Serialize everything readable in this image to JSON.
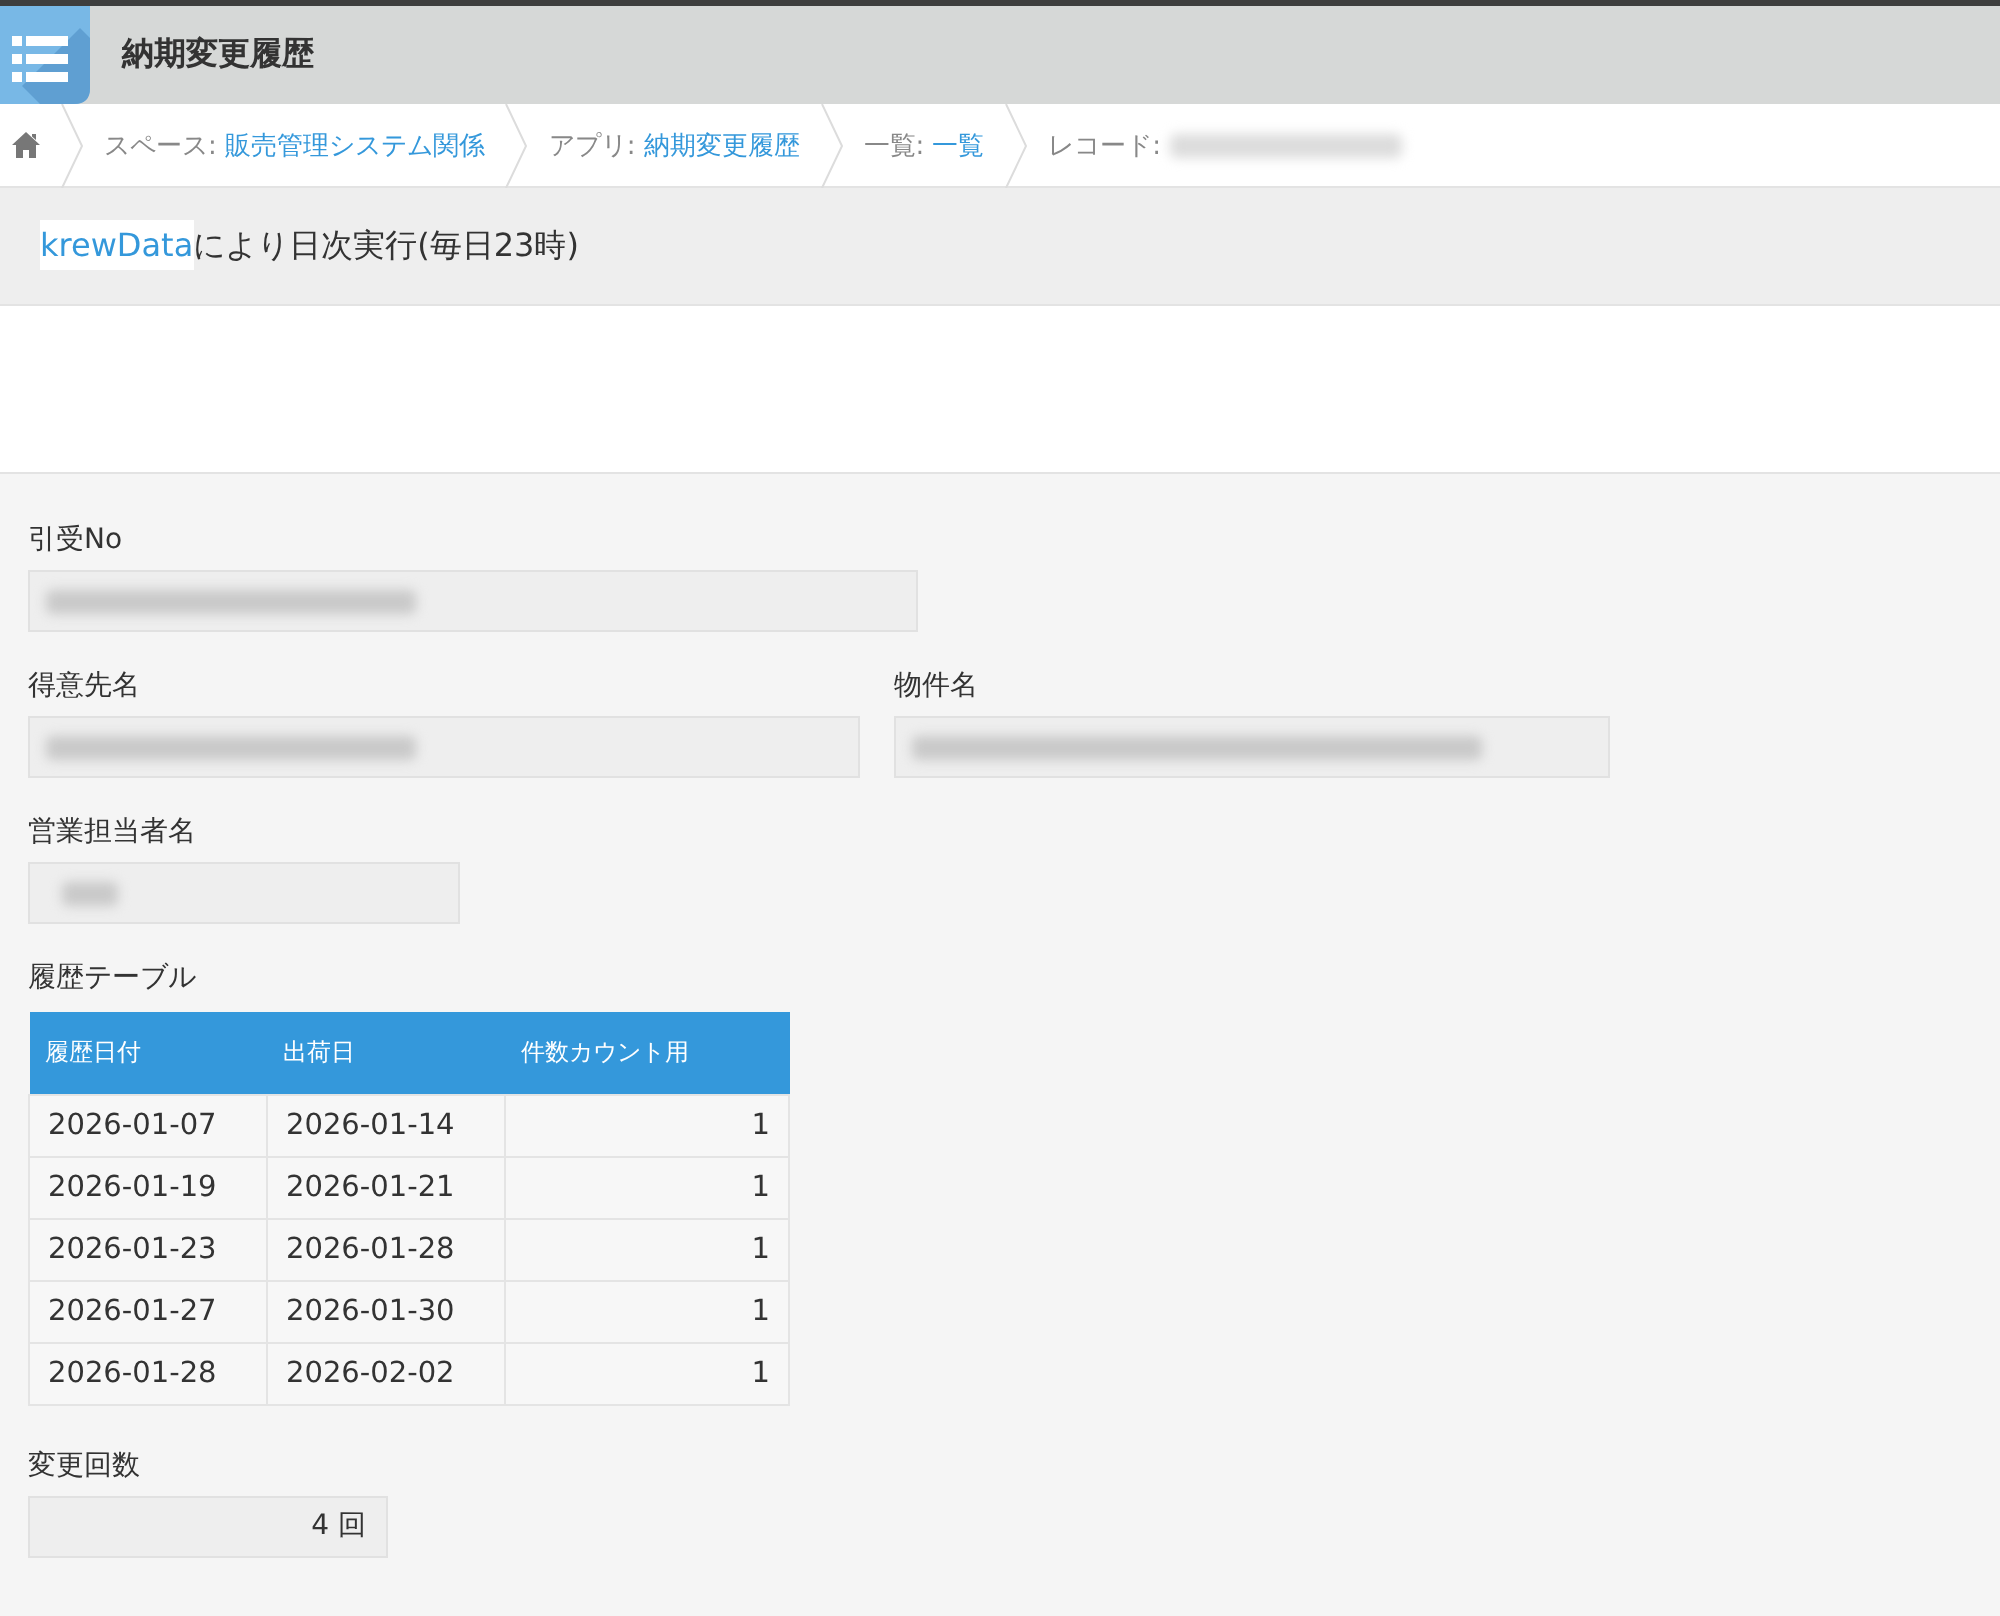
{
  "header": {
    "title": "納期変更履歴"
  },
  "breadcrumb": [
    {
      "label": "スペース:",
      "link": "販売管理システム関係",
      "redacted": false
    },
    {
      "label": "アプリ:",
      "link": "納期変更履歴",
      "redacted": false
    },
    {
      "label": "一覧:",
      "link": "一覧",
      "redacted": false
    },
    {
      "label": "レコード:",
      "redacted": true
    }
  ],
  "notice": {
    "link": "krewData",
    "text": "により日次実行(毎日23時)"
  },
  "form": [
    {
      "kind": "fields",
      "fields": [
        {
          "label": "引受No",
          "kind": "text",
          "redacted": true
        }
      ]
    },
    {
      "kind": "fields",
      "fields": [
        {
          "label": "得意先名",
          "kind": "text",
          "redacted": true
        },
        {
          "label": "物件名",
          "kind": "text",
          "redacted": true
        }
      ]
    },
    {
      "kind": "fields",
      "fields": [
        {
          "label": "営業担当者名",
          "kind": "text",
          "redacted": true
        }
      ]
    },
    {
      "kind": "table",
      "label": "履歴テーブル",
      "columns": [
        "履歴日付",
        "出荷日",
        "件数カウント用"
      ],
      "rows": [
        [
          "2026-01-07",
          "2026-01-14",
          "1"
        ],
        [
          "2026-01-19",
          "2026-01-21",
          "1"
        ],
        [
          "2026-01-23",
          "2026-01-28",
          "1"
        ],
        [
          "2026-01-27",
          "2026-01-30",
          "1"
        ],
        [
          "2026-01-28",
          "2026-02-02",
          "1"
        ]
      ]
    },
    {
      "kind": "fields",
      "fields": [
        {
          "label": "変更回数",
          "kind": "number",
          "value": "4 回",
          "redacted": false
        }
      ]
    }
  ]
}
